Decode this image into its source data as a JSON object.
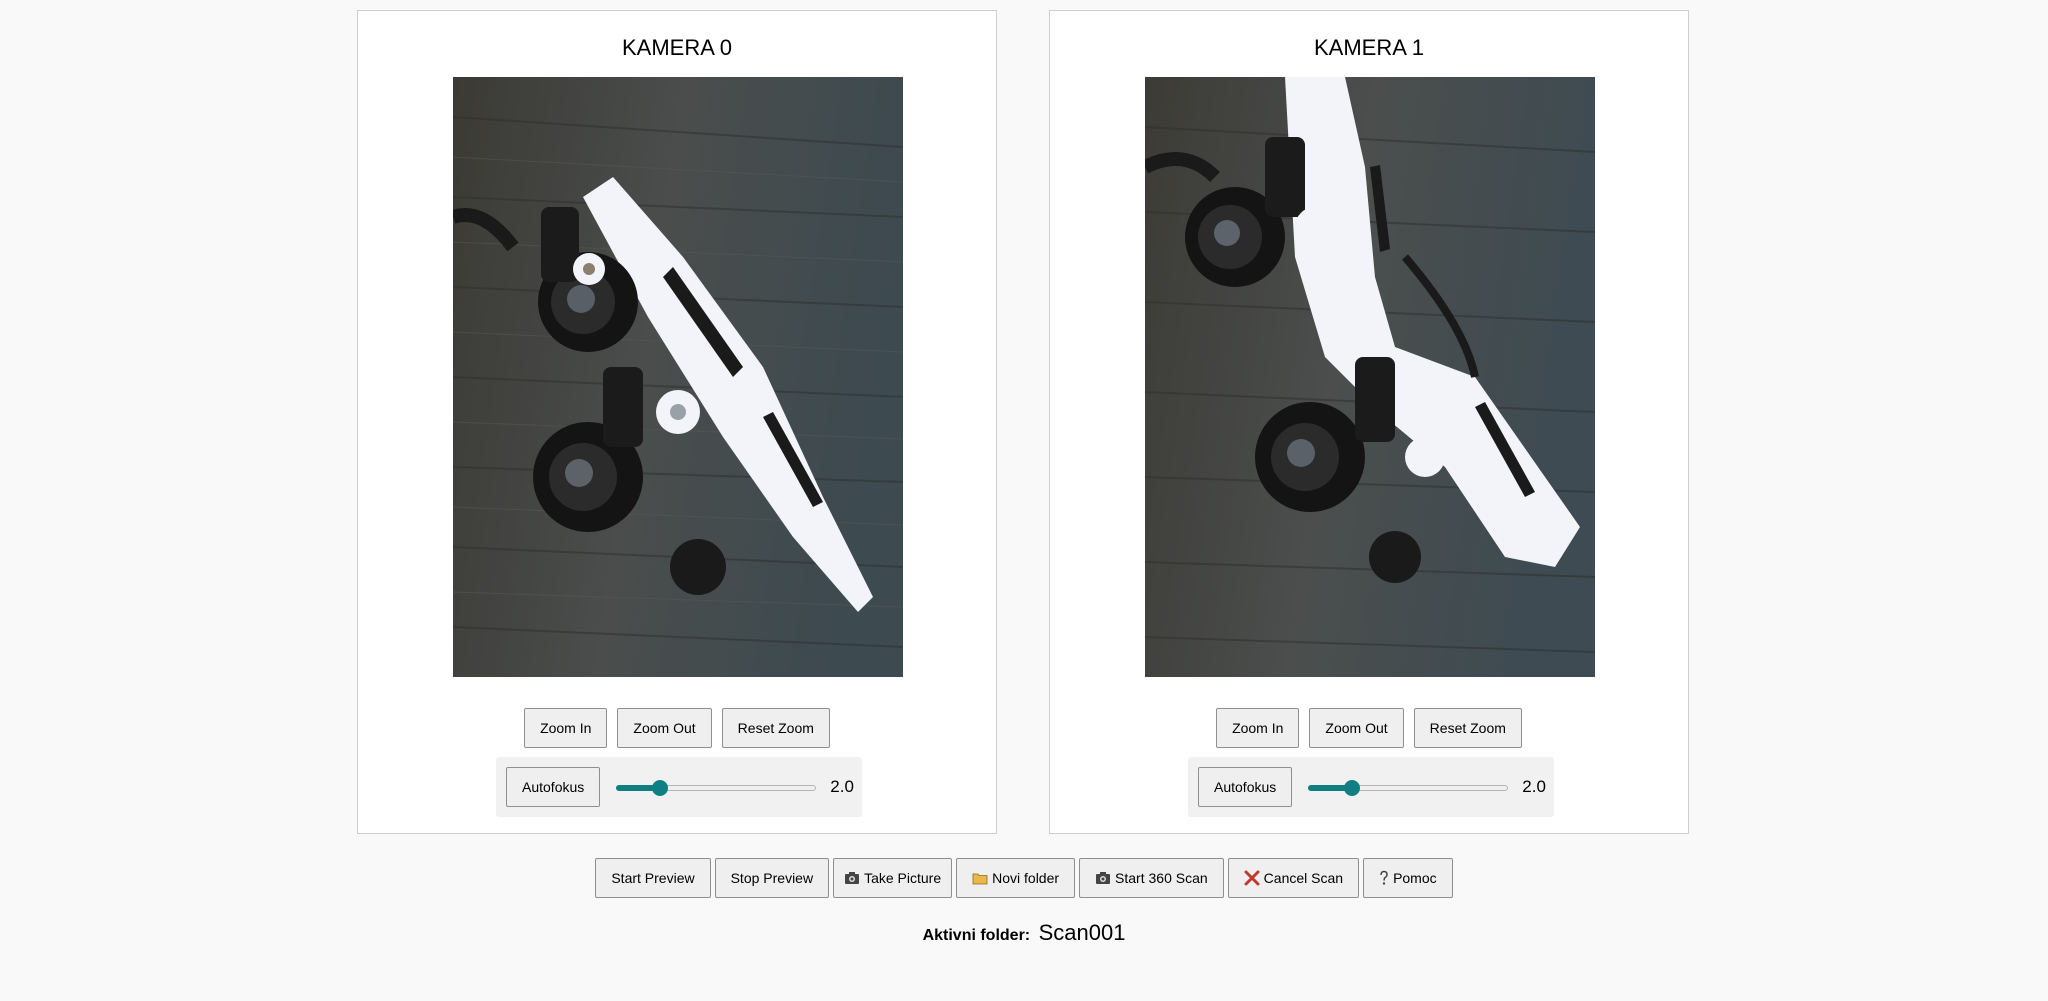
{
  "cameras": [
    {
      "title": "KAMERA 0",
      "zoom_in": "Zoom In",
      "zoom_out": "Zoom Out",
      "reset_zoom": "Reset Zoom",
      "autofocus": "Autofokus",
      "focus_value": "2.0",
      "focus_fraction": 0.22
    },
    {
      "title": "KAMERA 1",
      "zoom_in": "Zoom In",
      "zoom_out": "Zoom Out",
      "reset_zoom": "Reset Zoom",
      "autofocus": "Autofokus",
      "focus_value": "2.0",
      "focus_fraction": 0.22
    }
  ],
  "toolbar": {
    "start_preview": "Start Preview",
    "stop_preview": "Stop Preview",
    "take_picture": "Take Picture",
    "new_folder": "Novi folder",
    "start_scan": "Start 360 Scan",
    "cancel_scan": "Cancel Scan",
    "help": "Pomoc"
  },
  "folder": {
    "label": "Aktivni folder:",
    "value": "Scan001"
  },
  "colors": {
    "accent": "#0f7f83",
    "cancel": "#c0392b",
    "folder_icon": "#e8b84a"
  },
  "icons": {
    "take_picture": "camera-icon",
    "new_folder": "folder-icon",
    "start_scan": "camera-icon",
    "cancel_scan": "cross-icon",
    "help": "question-icon"
  }
}
